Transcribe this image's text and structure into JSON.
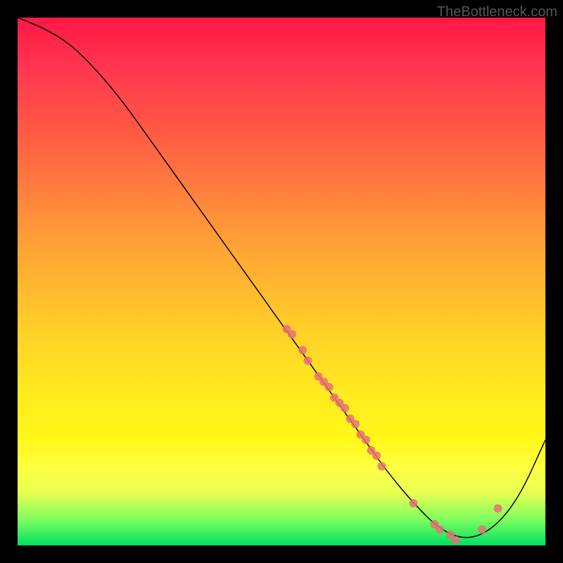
{
  "watermark": "TheBottleneck.com",
  "chart_data": {
    "type": "line",
    "title": "",
    "xlabel": "",
    "ylabel": "",
    "xlim": [
      0,
      100
    ],
    "ylim": [
      0,
      100
    ],
    "series": [
      {
        "name": "curve",
        "x": [
          0,
          5,
          10,
          15,
          20,
          25,
          30,
          35,
          40,
          45,
          50,
          55,
          60,
          65,
          70,
          75,
          80,
          85,
          90,
          95,
          100
        ],
        "y": [
          100,
          98,
          95,
          90,
          84,
          77,
          70,
          63,
          56,
          49,
          42,
          35,
          28,
          21,
          14,
          8,
          3,
          1,
          3,
          9,
          20
        ]
      }
    ],
    "markers": {
      "name": "highlighted-points",
      "x": [
        51,
        52,
        54,
        55,
        57,
        58,
        59,
        60,
        61,
        62,
        63,
        64,
        65,
        66,
        67,
        68,
        69,
        75,
        79,
        80,
        82,
        83,
        88,
        91
      ],
      "y": [
        41,
        40,
        37,
        35,
        32,
        31,
        30,
        28,
        27,
        26,
        24,
        23,
        21,
        20,
        18,
        17,
        15,
        8,
        4,
        3,
        2,
        1,
        3,
        7
      ]
    }
  }
}
